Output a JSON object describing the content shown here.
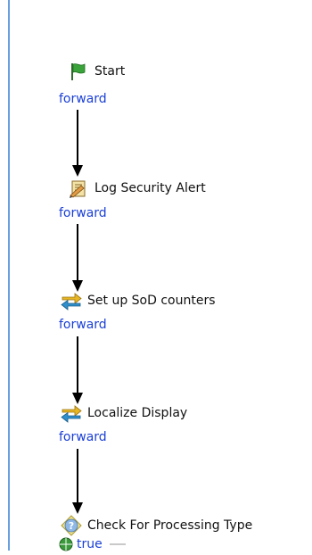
{
  "nodes": [
    {
      "label": "Start",
      "icon": "green-flag-icon"
    },
    {
      "label": "Log Security Alert",
      "icon": "log-pencil-icon"
    },
    {
      "label": "Set up SoD counters",
      "icon": "swap-arrows-icon"
    },
    {
      "label": "Localize Display",
      "icon": "swap-arrows-icon"
    },
    {
      "label": "Check For Processing Type",
      "icon": "question-diamond-icon"
    }
  ],
  "transitions": [
    {
      "label": "forward"
    },
    {
      "label": "forward"
    },
    {
      "label": "forward"
    },
    {
      "label": "forward"
    },
    {
      "label": "true"
    }
  ],
  "colors": {
    "link": "#1a3fd6",
    "accent_rule": "#6aa0df",
    "flag_green": "#3aa33a",
    "swap_blue": "#2f8fcb",
    "swap_yellow": "#e7b623"
  }
}
